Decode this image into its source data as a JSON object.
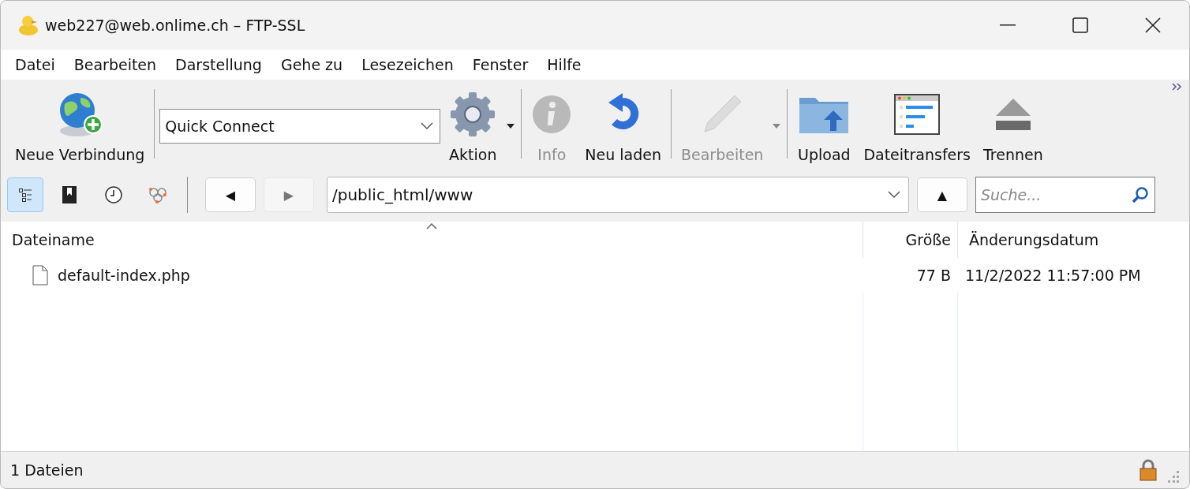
{
  "window": {
    "title": "web227@web.onlime.ch – FTP-SSL"
  },
  "menu": [
    "Datei",
    "Bearbeiten",
    "Darstellung",
    "Gehe zu",
    "Lesezeichen",
    "Fenster",
    "Hilfe"
  ],
  "toolbar": {
    "groups": [
      [
        {
          "kind": "globe",
          "label": "Neue Verbindung",
          "disabled": false,
          "dropdown": false
        }
      ],
      [
        {
          "kind": "combo",
          "value": "Quick Connect"
        },
        {
          "kind": "gear",
          "label": "Aktion",
          "disabled": false,
          "dropdown": true
        }
      ],
      [
        {
          "kind": "info",
          "label": "Info",
          "disabled": true,
          "dropdown": false
        },
        {
          "kind": "reload",
          "label": "Neu laden",
          "disabled": false,
          "dropdown": false
        }
      ],
      [
        {
          "kind": "pencil",
          "label": "Bearbeiten",
          "disabled": true,
          "dropdown": true
        }
      ],
      [
        {
          "kind": "upload",
          "label": "Upload",
          "disabled": false,
          "dropdown": false
        },
        {
          "kind": "transfers",
          "label": "Dateitransfers",
          "disabled": false,
          "dropdown": false
        },
        {
          "kind": "eject",
          "label": "Trennen",
          "disabled": false,
          "dropdown": false
        }
      ]
    ]
  },
  "nav": {
    "views": [
      {
        "kind": "outline",
        "selected": true
      },
      {
        "kind": "bookmarks",
        "selected": false
      },
      {
        "kind": "history",
        "selected": false
      },
      {
        "kind": "bonjour",
        "selected": false
      }
    ],
    "back": {
      "label": "◀",
      "disabled": false
    },
    "forward": {
      "label": "▶",
      "disabled": true
    },
    "path": "/public_html/www",
    "up": {
      "label": "▲"
    },
    "search": {
      "placeholder": "Suche..."
    }
  },
  "table": {
    "columns": [
      {
        "label": "Dateiname",
        "sorted": true
      },
      {
        "label": "Größe",
        "sorted": false
      },
      {
        "label": "Änderungsdatum",
        "sorted": false
      }
    ],
    "rows": [
      {
        "cells": [
          "default-index.php",
          "77 B",
          "11/2/2022 11:57:00 PM"
        ]
      }
    ]
  },
  "status_bar": {
    "text": "1 Dateien",
    "secure": true
  }
}
